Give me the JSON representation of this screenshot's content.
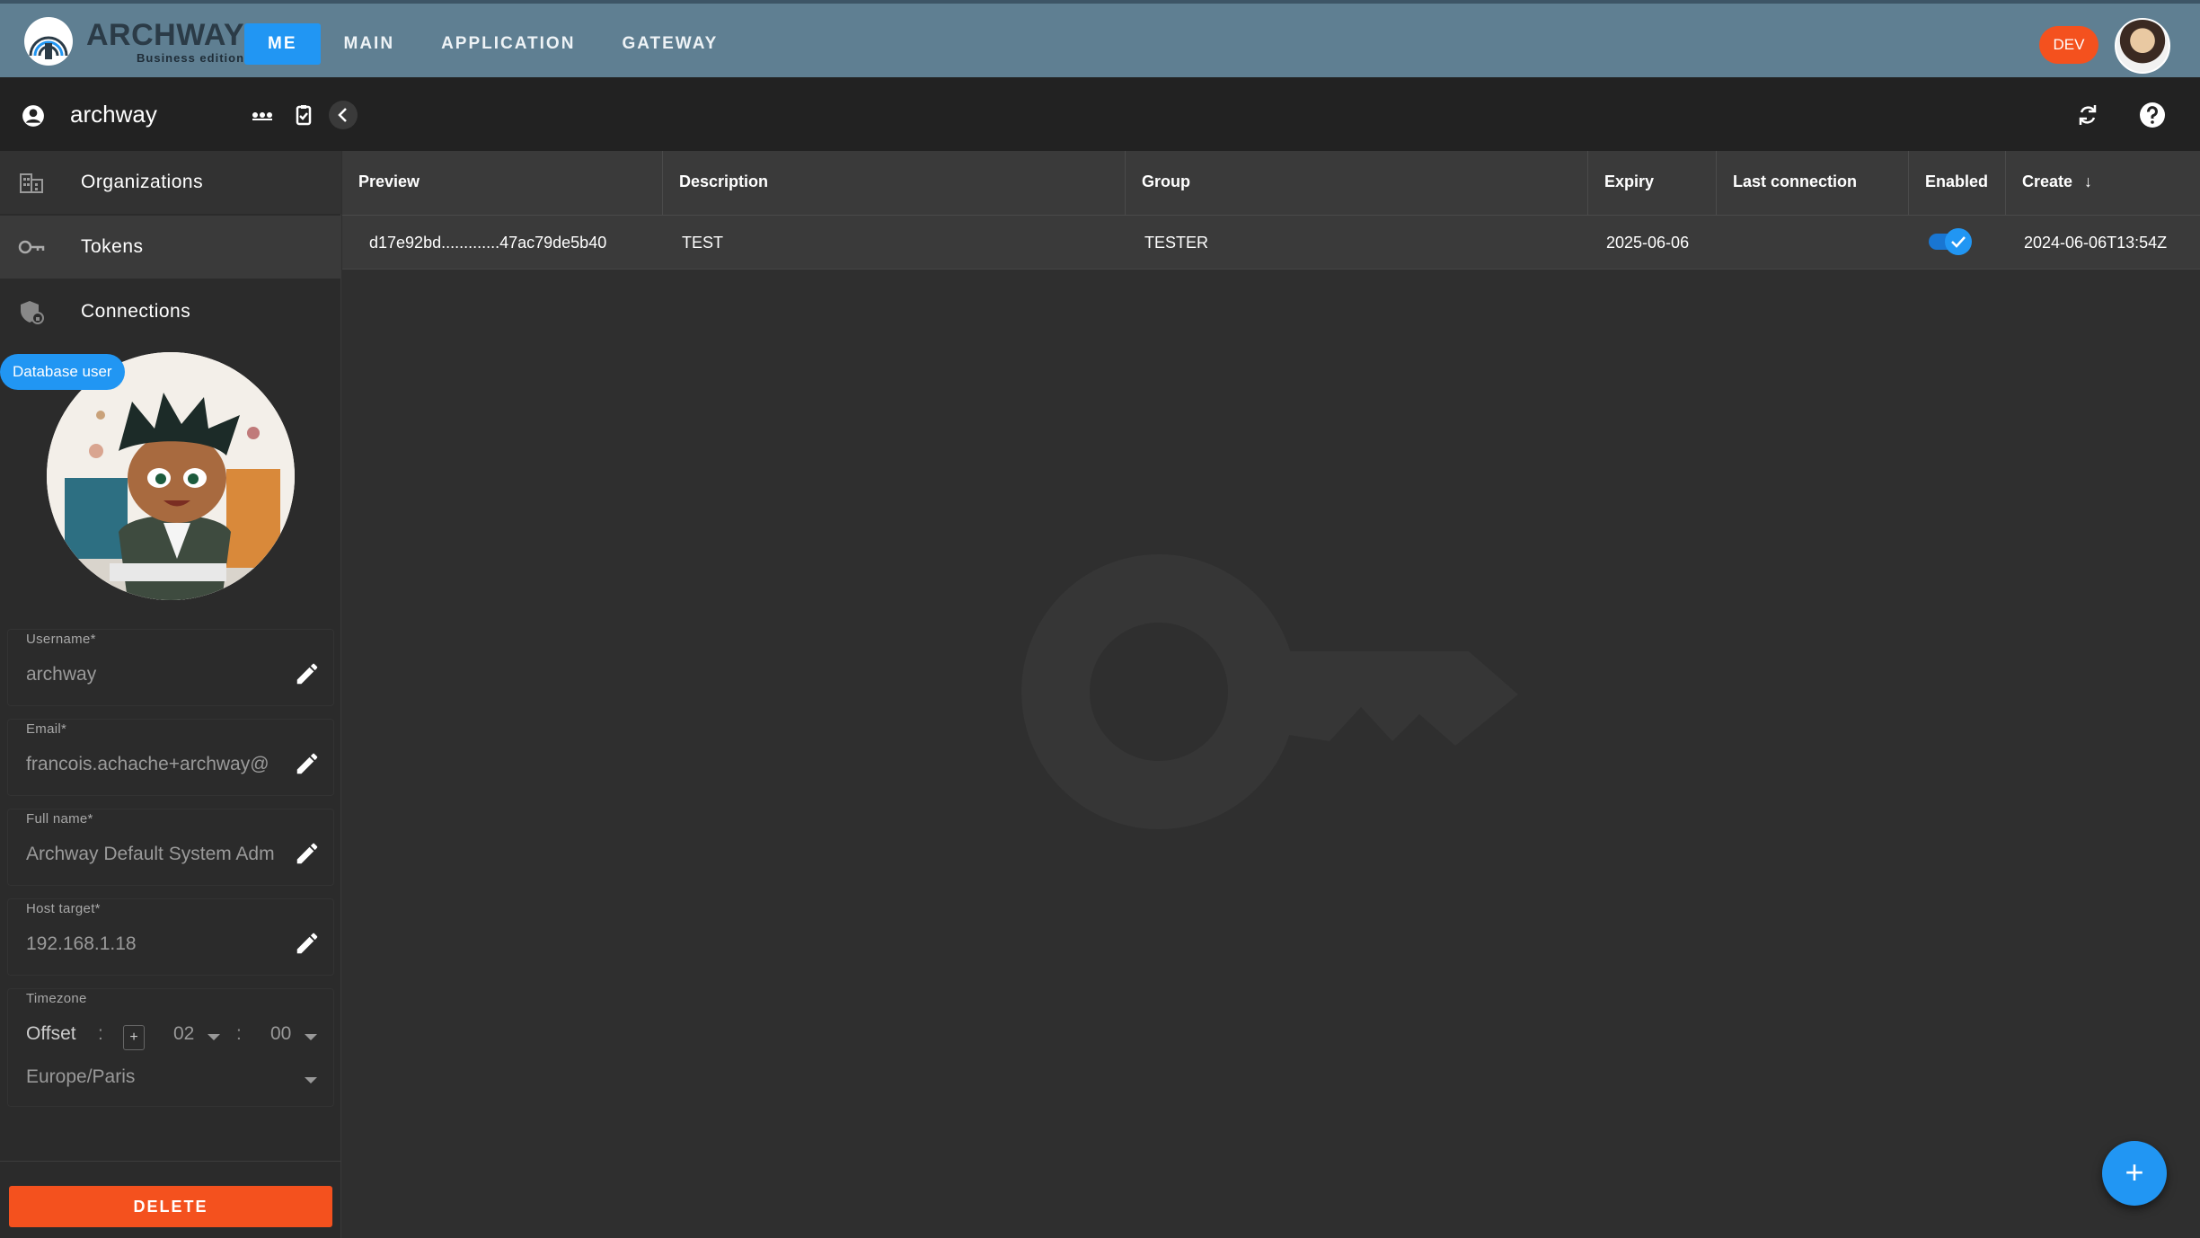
{
  "brand": {
    "title": "ARCHWAY",
    "subtitle": "Business edition"
  },
  "nav": {
    "items": [
      {
        "label": "ME",
        "active": true
      },
      {
        "label": "MAIN",
        "active": false
      },
      {
        "label": "APPLICATION",
        "active": false
      },
      {
        "label": "GATEWAY",
        "active": false
      }
    ],
    "env_badge": "DEV"
  },
  "subheader": {
    "user_name": "archway",
    "icons": [
      "account-circle-icon",
      "more-horizontal-icon",
      "clipboard-check-icon",
      "chevron-left-icon",
      "refresh-icon",
      "help-icon"
    ]
  },
  "sidebar": {
    "items": [
      {
        "label": "Organizations",
        "icon": "building-icon"
      },
      {
        "label": "Tokens",
        "icon": "key-icon",
        "active": true
      },
      {
        "label": "Connections",
        "icon": "shield-lock-icon"
      }
    ],
    "role_chip": "Database user",
    "fields": [
      {
        "label": "Username*",
        "value": "archway"
      },
      {
        "label": "Email*",
        "value": "francois.achache+archway@"
      },
      {
        "label": "Full name*",
        "value": "Archway Default System Adm"
      },
      {
        "label": "Host target*",
        "value": "192.168.1.18"
      }
    ],
    "timezone": {
      "label": "Timezone",
      "offset_label": "Offset",
      "sep1": ":",
      "sign": "+",
      "hours": "02",
      "sep2": ":",
      "minutes": "00",
      "zone": "Europe/Paris"
    },
    "delete_label": "DELETE"
  },
  "table": {
    "columns": [
      "Preview",
      "Description",
      "Group",
      "Expiry",
      "Last connection",
      "Enabled",
      "Create"
    ],
    "sort_indicator": "↓",
    "rows": [
      {
        "preview": "d17e92bd.............47ac79de5b40",
        "description": "TEST",
        "group": "TESTER",
        "expiry": "2025-06-06",
        "last_connection": "",
        "enabled": true,
        "create": "2024-06-06T13:54Z"
      }
    ]
  },
  "fab_label": "+",
  "colors": {
    "accent": "#2196f3",
    "danger": "#f4511e",
    "topbar": "#5f7f92"
  }
}
